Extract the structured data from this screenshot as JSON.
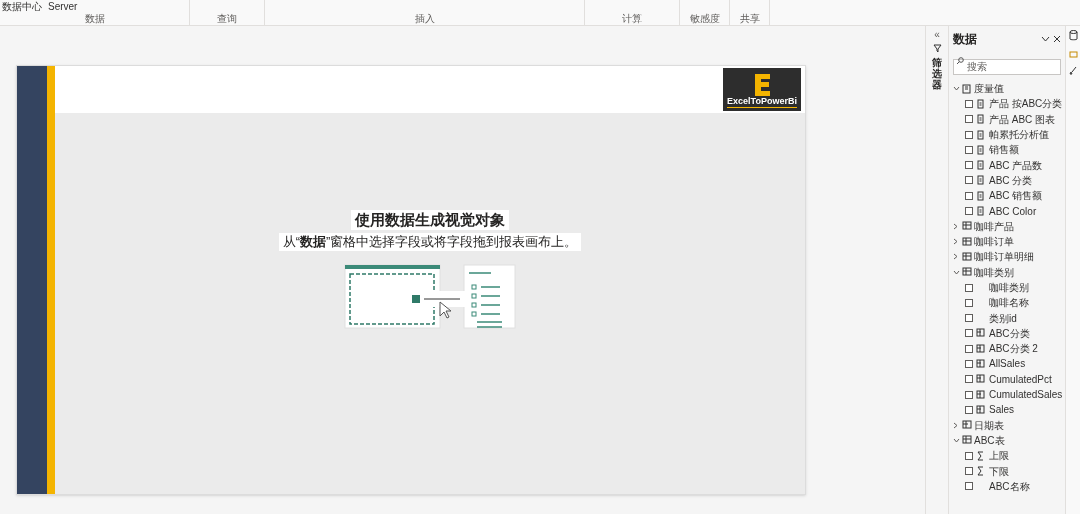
{
  "ribbon": {
    "top_items": [
      {
        "label": "数据中心"
      },
      {
        "label": "Server"
      }
    ],
    "groups": [
      {
        "label": "数据"
      },
      {
        "label": "查询"
      },
      {
        "label": "插入"
      },
      {
        "label": "计算"
      },
      {
        "label": "敏感度"
      },
      {
        "label": "共享"
      }
    ]
  },
  "canvas": {
    "logo": "ExcelToPowerBi",
    "placeholder_title": "使用数据生成视觉对象",
    "placeholder_text": "从“**数据**”窗格中选择字段或将字段拖到报表画布上。"
  },
  "filters_tab": {
    "expand_glyph": "«",
    "label": "筛选器"
  },
  "data_pane": {
    "title": "数据",
    "search": {
      "placeholder": "搜索"
    },
    "tables": [
      {
        "name": "度量值",
        "kind": "measures",
        "expanded": true,
        "fields": [
          {
            "name": "产品 按ABC分类",
            "kind": "measure",
            "checked": false
          },
          {
            "name": "产品 ABC 图表",
            "kind": "measure",
            "checked": false
          },
          {
            "name": "帕累托分析值",
            "kind": "measure",
            "checked": false
          },
          {
            "name": "销售额",
            "kind": "measure",
            "checked": false
          },
          {
            "name": "ABC 产品数",
            "kind": "measure",
            "checked": false
          },
          {
            "name": "ABC 分类",
            "kind": "measure",
            "checked": false
          },
          {
            "name": "ABC 销售额",
            "kind": "measure",
            "checked": false
          },
          {
            "name": "ABC Color",
            "kind": "measure",
            "checked": false
          }
        ]
      },
      {
        "name": "咖啡产品",
        "kind": "table",
        "expanded": false
      },
      {
        "name": "咖啡订单",
        "kind": "table",
        "expanded": false
      },
      {
        "name": "咖啡订单明细",
        "kind": "table",
        "expanded": false
      },
      {
        "name": "咖啡类别",
        "kind": "table",
        "expanded": true,
        "fields": [
          {
            "name": "咖啡类别",
            "kind": "column",
            "checked": false
          },
          {
            "name": "咖啡名称",
            "kind": "column",
            "checked": false
          },
          {
            "name": "类别id",
            "kind": "column",
            "checked": false
          },
          {
            "name": "ABC分类",
            "kind": "calc_column",
            "checked": false
          },
          {
            "name": "ABC分类 2",
            "kind": "calc_column",
            "checked": false
          },
          {
            "name": "AllSales",
            "kind": "calc_column",
            "checked": false
          },
          {
            "name": "CumulatedPct",
            "kind": "calc_column",
            "checked": false
          },
          {
            "name": "CumulatedSales",
            "kind": "calc_column",
            "checked": false
          },
          {
            "name": "Sales",
            "kind": "calc_column",
            "checked": false
          }
        ]
      },
      {
        "name": "日期表",
        "kind": "calc_table",
        "expanded": false
      },
      {
        "name": "ABC表",
        "kind": "table",
        "expanded": true,
        "fields": [
          {
            "name": "上限",
            "kind": "sum",
            "checked": false
          },
          {
            "name": "下限",
            "kind": "sum",
            "checked": false
          },
          {
            "name": "ABC名称",
            "kind": "column",
            "checked": false
          }
        ]
      }
    ]
  }
}
